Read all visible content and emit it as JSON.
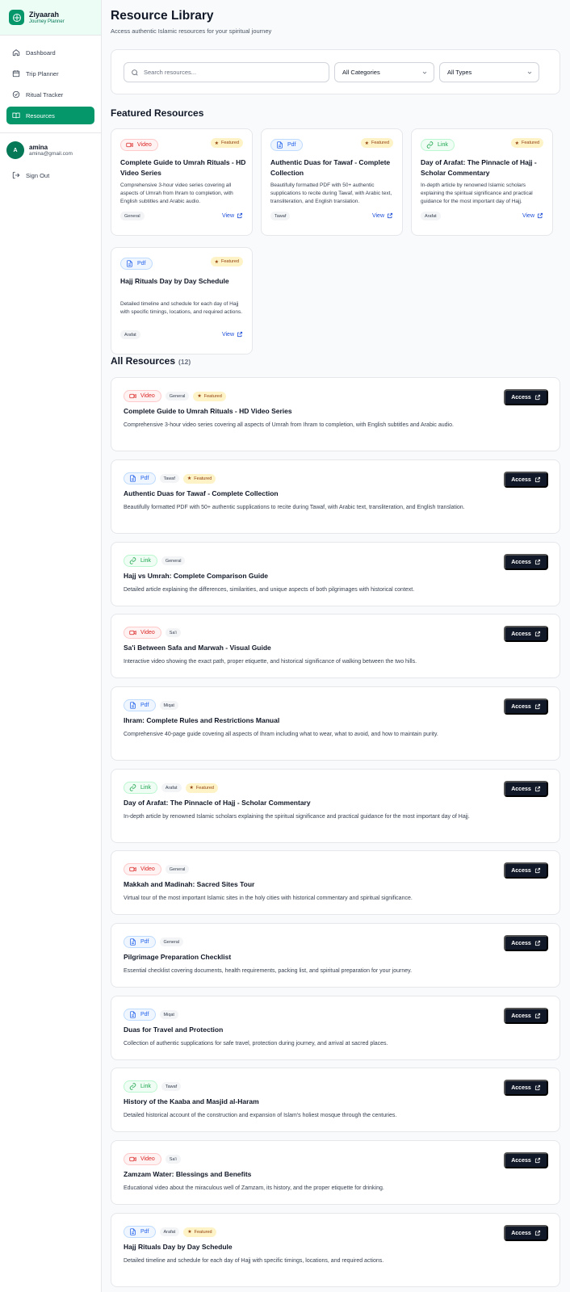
{
  "brand": {
    "title": "Ziyaarah",
    "subtitle": "Journey Planner",
    "icon": "compass-icon"
  },
  "sidebar": {
    "items": [
      {
        "label": "Dashboard",
        "icon": "home-icon"
      },
      {
        "label": "Trip Planner",
        "icon": "calendar-icon"
      },
      {
        "label": "Ritual Tracker",
        "icon": "check-circle-icon"
      },
      {
        "label": "Resources",
        "icon": "book-open-icon",
        "active": true
      }
    ]
  },
  "user": {
    "initial": "A",
    "name": "amina",
    "email": "amina@gmail.com",
    "signout": "Sign Out"
  },
  "page": {
    "title": "Resource Library",
    "subtitle": "Access authentic Islamic resources for your spiritual journey"
  },
  "filters": {
    "search_placeholder": "Search resources...",
    "category": "All Categories",
    "type": "All Types"
  },
  "featured": {
    "heading": "Featured Resources",
    "featured_label": "Featured",
    "view_label": "View",
    "cards": [
      {
        "type": "Video",
        "title": "Complete Guide to Umrah Rituals - HD Video Series",
        "desc": "Comprehensive 3-hour video series covering all aspects of Umrah from Ihram to completion, with English subtitles and Arabic audio.",
        "tag": "General"
      },
      {
        "type": "Pdf",
        "title": "Authentic Duas for Tawaf - Complete Collection",
        "desc": "Beautifully formatted PDF with 50+ authentic supplications to recite during Tawaf, with Arabic text, transliteration, and English translation.",
        "tag": "Tawaf"
      },
      {
        "type": "Link",
        "title": "Day of Arafat: The Pinnacle of Hajj - Scholar Commentary",
        "desc": "In-depth article by renowned Islamic scholars explaining the spiritual significance and practical guidance for the most important day of Hajj.",
        "tag": "Arafat"
      },
      {
        "type": "Pdf",
        "title": "Hajj Rituals Day by Day Schedule",
        "desc": "Detailed timeline and schedule for each day of Hajj with specific timings, locations, and required actions.",
        "tag": "Arafat"
      }
    ]
  },
  "all": {
    "heading": "All Resources",
    "count": "(12)",
    "access_label": "Access",
    "featured_label": "Featured",
    "rows": [
      {
        "type": "Video",
        "tag": "General",
        "featured": true,
        "title": "Complete Guide to Umrah Rituals - HD Video Series",
        "desc": "Comprehensive 3-hour video series covering all aspects of Umrah from Ihram to completion, with English subtitles and Arabic audio."
      },
      {
        "type": "Pdf",
        "tag": "Tawaf",
        "featured": true,
        "title": "Authentic Duas for Tawaf - Complete Collection",
        "desc": "Beautifully formatted PDF with 50+ authentic supplications to recite during Tawaf, with Arabic text, transliteration, and English translation."
      },
      {
        "type": "Link",
        "tag": "General",
        "featured": false,
        "title": "Hajj vs Umrah: Complete Comparison Guide",
        "desc": "Detailed article explaining the differences, similarities, and unique aspects of both pilgrimages with historical context."
      },
      {
        "type": "Video",
        "tag": "Sa'i",
        "featured": false,
        "title": "Sa'i Between Safa and Marwah - Visual Guide",
        "desc": "Interactive video showing the exact path, proper etiquette, and historical significance of walking between the two hills."
      },
      {
        "type": "Pdf",
        "tag": "Miqat",
        "featured": false,
        "title": "Ihram: Complete Rules and Restrictions Manual",
        "desc": "Comprehensive 40-page guide covering all aspects of Ihram including what to wear, what to avoid, and how to maintain purity."
      },
      {
        "type": "Link",
        "tag": "Arafat",
        "featured": true,
        "title": "Day of Arafat: The Pinnacle of Hajj - Scholar Commentary",
        "desc": "In-depth article by renowned Islamic scholars explaining the spiritual significance and practical guidance for the most important day of Hajj."
      },
      {
        "type": "Video",
        "tag": "General",
        "featured": false,
        "title": "Makkah and Madinah: Sacred Sites Tour",
        "desc": "Virtual tour of the most important Islamic sites in the holy cities with historical commentary and spiritual significance."
      },
      {
        "type": "Pdf",
        "tag": "General",
        "featured": false,
        "title": "Pilgrimage Preparation Checklist",
        "desc": "Essential checklist covering documents, health requirements, packing list, and spiritual preparation for your journey."
      },
      {
        "type": "Pdf",
        "tag": "Miqat",
        "featured": false,
        "title": "Duas for Travel and Protection",
        "desc": "Collection of authentic supplications for safe travel, protection during journey, and arrival at sacred places."
      },
      {
        "type": "Link",
        "tag": "Tawaf",
        "featured": false,
        "title": "History of the Kaaba and Masjid al-Haram",
        "desc": "Detailed historical account of the construction and expansion of Islam's holiest mosque through the centuries."
      },
      {
        "type": "Video",
        "tag": "Sa'i",
        "featured": false,
        "title": "Zamzam Water: Blessings and Benefits",
        "desc": "Educational video about the miraculous well of Zamzam, its history, and the proper etiquette for drinking."
      },
      {
        "type": "Pdf",
        "tag": "Arafat",
        "featured": true,
        "title": "Hajj Rituals Day by Day Schedule",
        "desc": "Detailed timeline and schedule for each day of Hajj with specific timings, locations, and required actions."
      }
    ]
  },
  "colors": {
    "accent": "#059669",
    "video": "#dc2626",
    "pdf": "#2563eb",
    "link": "#16a34a",
    "featured": "#fef3c7",
    "access_button": "#111827"
  }
}
